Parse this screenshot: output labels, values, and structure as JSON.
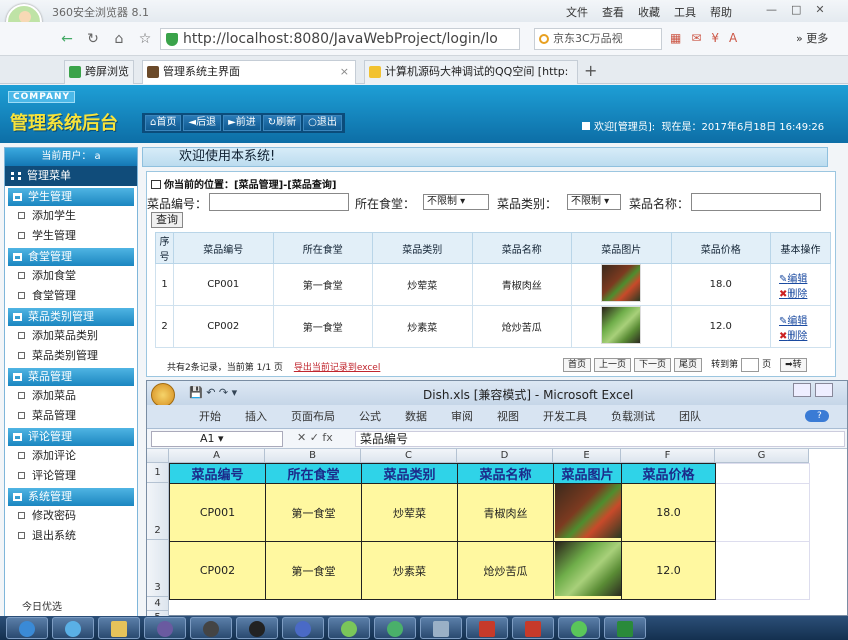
{
  "browser": {
    "title": "360安全浏览器 8.1",
    "menu": [
      "文件",
      "查看",
      "收藏",
      "工具",
      "帮助"
    ],
    "url": "http://localhost:8080/JavaWebProject/login/lo",
    "search_text": "京东3C万品视",
    "more_label": "更多",
    "tabs": [
      {
        "label": "跨屏浏览"
      },
      {
        "label": "管理系统主界面"
      },
      {
        "label": "计算机源码大神调试的QQ空间 [http:"
      }
    ]
  },
  "site": {
    "company": "COMPANY",
    "title": "管理系统后台",
    "nav": [
      "首页",
      "后退",
      "前进",
      "刷新",
      "退出"
    ],
    "welcome": "欢迎[管理员]:",
    "now_prefix": "现在是：",
    "datetime": "2017年6月18日  16:49:26"
  },
  "sidebar": {
    "current_user_label": "当前用户：",
    "current_user": "a",
    "menu_title": "管理菜单",
    "groups": [
      {
        "title": "学生管理",
        "items": [
          "添加学生",
          "学生管理"
        ]
      },
      {
        "title": "食堂管理",
        "items": [
          "添加食堂",
          "食堂管理"
        ]
      },
      {
        "title": "菜品类别管理",
        "items": [
          "添加菜品类别",
          "菜品类别管理"
        ]
      },
      {
        "title": "菜品管理",
        "items": [
          "添加菜品",
          "菜品管理"
        ]
      },
      {
        "title": "评论管理",
        "items": [
          "添加评论",
          "评论管理"
        ]
      },
      {
        "title": "系统管理",
        "items": [
          "修改密码",
          "退出系统"
        ]
      }
    ],
    "today": "今日优选"
  },
  "main": {
    "welcome_text": "欢迎使用本系统!",
    "location": "你当前的位置：[菜品管理]-[菜品查询]",
    "filters": {
      "code_label": "菜品编号：",
      "canteen_label": "所在食堂：",
      "canteen_value": "不限制",
      "category_label": "菜品类别：",
      "category_value": "不限制",
      "name_label": "菜品名称：",
      "query_button": "查询"
    },
    "table": {
      "headers": [
        "序号",
        "菜品编号",
        "所在食堂",
        "菜品类别",
        "菜品名称",
        "菜品图片",
        "菜品价格",
        "基本操作"
      ],
      "rows": [
        {
          "no": "1",
          "code": "CP001",
          "canteen": "第一食堂",
          "category": "炒荤菜",
          "name": "青椒肉丝",
          "price": "18.0"
        },
        {
          "no": "2",
          "code": "CP002",
          "canteen": "第一食堂",
          "category": "炒素菜",
          "name": "炝炒苦瓜",
          "price": "12.0"
        }
      ],
      "edit_label": "编辑",
      "delete_label": "删除"
    },
    "pager": {
      "summary": "共有2条记录，当前第 1/1 页",
      "export": "导出当前记录到excel",
      "buttons": [
        "首页",
        "上一页",
        "下一页",
        "尾页"
      ],
      "goto_label": "转到第",
      "page_suffix": "页",
      "go_button": "转"
    }
  },
  "excel": {
    "title": "Dish.xls  [兼容模式] - Microsoft Excel",
    "ribbon": [
      "开始",
      "插入",
      "页面布局",
      "公式",
      "数据",
      "审阅",
      "视图",
      "开发工具",
      "负载测试",
      "团队"
    ],
    "name_box": "A1",
    "formula_value": "菜品编号",
    "columns": [
      "A",
      "B",
      "C",
      "D",
      "E",
      "F",
      "G"
    ],
    "row_numbers": [
      "1",
      "2",
      "3",
      "4",
      "5"
    ],
    "headers": [
      "菜品编号",
      "所在食堂",
      "菜品类别",
      "菜品名称",
      "菜品图片",
      "菜品价格"
    ],
    "rows": [
      {
        "code": "CP001",
        "canteen": "第一食堂",
        "category": "炒荤菜",
        "name": "青椒肉丝",
        "price": "18.0"
      },
      {
        "code": "CP002",
        "canteen": "第一食堂",
        "category": "炒素菜",
        "name": "炝炒苦瓜",
        "price": "12.0"
      }
    ]
  }
}
